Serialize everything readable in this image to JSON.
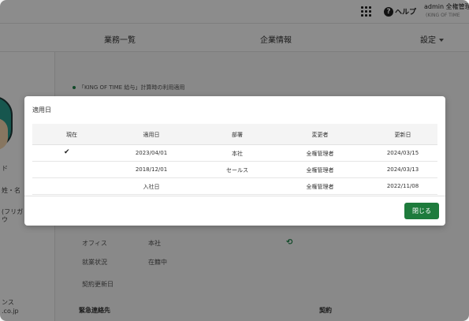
{
  "topbar": {
    "help_label": "ヘルプ",
    "user_name": "admin 全権管理",
    "user_sub": "(KING OF TIME"
  },
  "nav": {
    "items": [
      "業務一覧",
      "企業情報",
      "設定"
    ]
  },
  "left": {
    "labels": [
      "ド",
      "姓・名",
      "(フリガ",
      "ウ",
      "ンス",
      ".co.jp"
    ]
  },
  "banner": "「KING OF TIME 給与」計算時の利用適用",
  "background_rows": {
    "office_label": "オフィス",
    "office_value": "本社",
    "employment_label": "就業状況",
    "employment_value": "在籍中",
    "contract_label": "契約更新日",
    "emergency_label": "緊急連絡先",
    "contract_section": "契約"
  },
  "modal": {
    "title": "適用日",
    "headers": [
      "現在",
      "適用日",
      "部署",
      "変更者",
      "更新日"
    ],
    "rows": [
      {
        "current": "✔",
        "apply_date": "2023/04/01",
        "dept": "本社",
        "changer": "全権管理者",
        "updated": "2024/03/15"
      },
      {
        "current": "",
        "apply_date": "2018/12/01",
        "dept": "セールス",
        "changer": "全権管理者",
        "updated": "2024/03/13"
      },
      {
        "current": "",
        "apply_date": "入社日",
        "dept": "",
        "changer": "全権管理者",
        "updated": "2022/11/08"
      }
    ],
    "close_label": "閉じる"
  },
  "colors": {
    "accent": "#1e7b3c",
    "overlay": "rgba(0,0,0,0.45)"
  }
}
